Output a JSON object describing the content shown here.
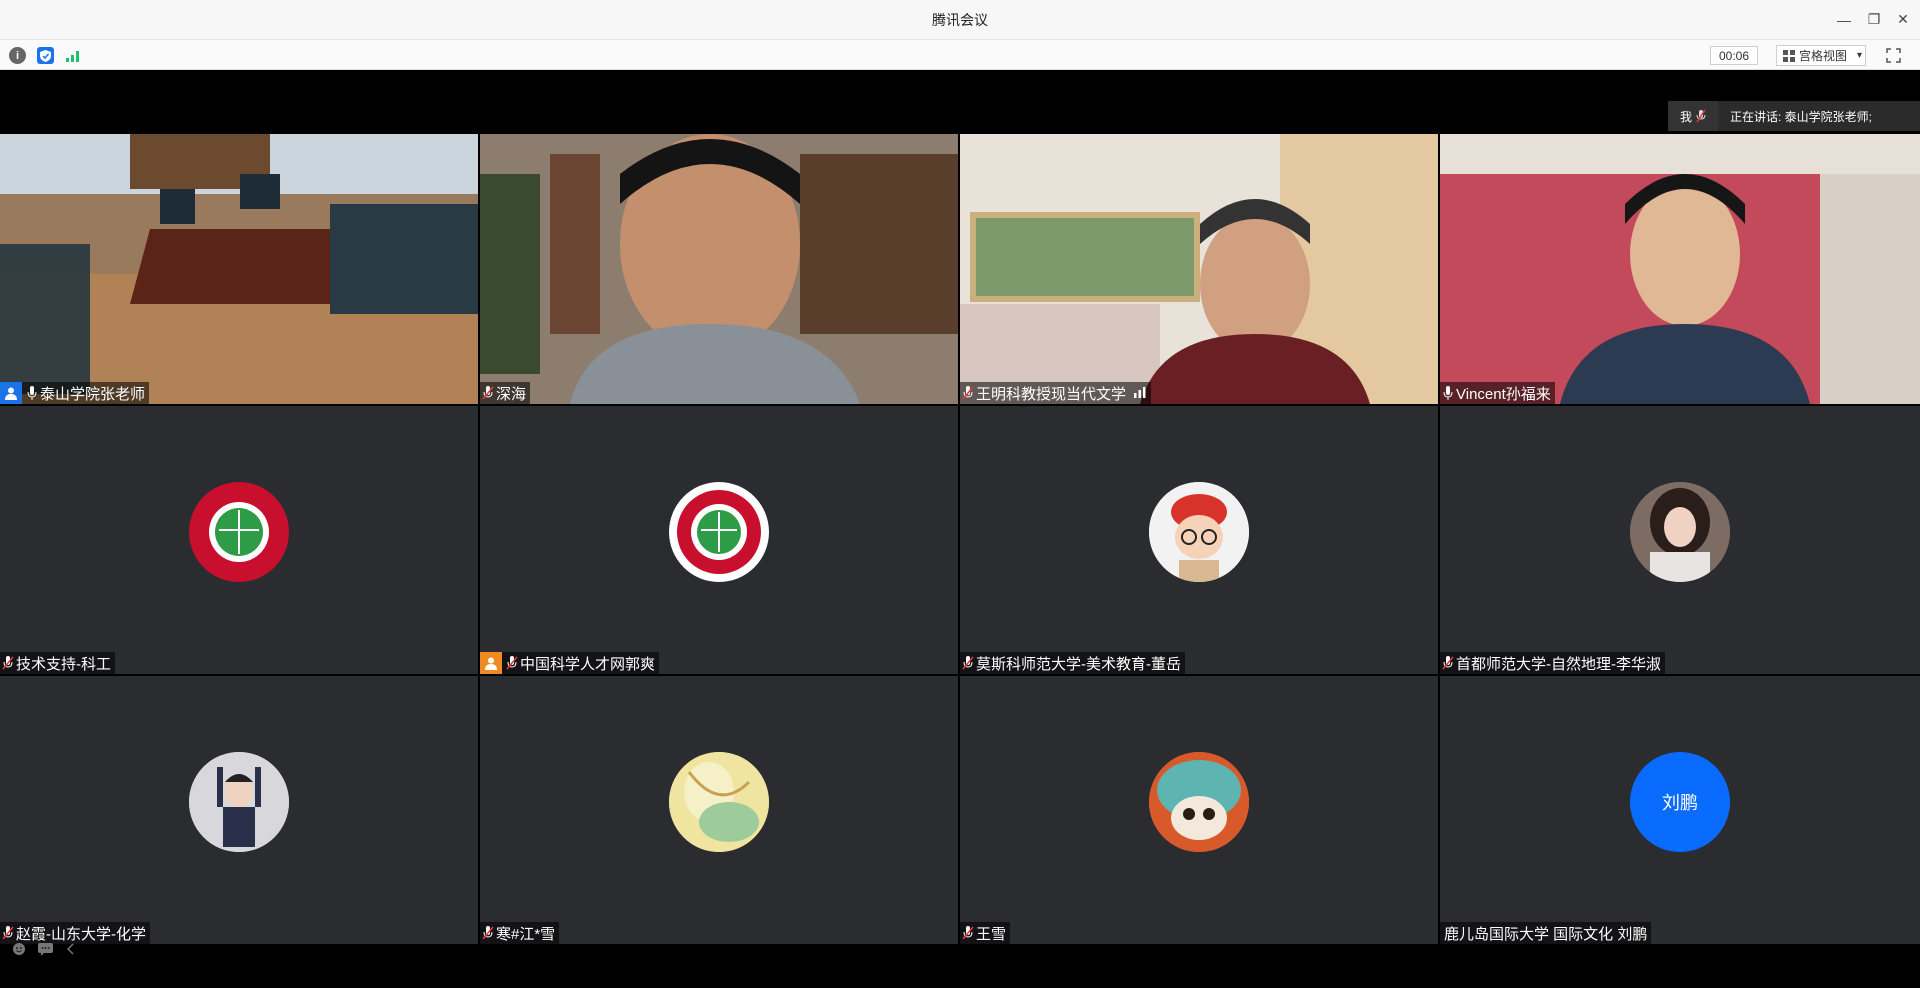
{
  "window": {
    "title": "腾讯会议",
    "minimize_label": "—",
    "restore_label": "❐",
    "close_label": "✕"
  },
  "toolbar": {
    "timer": "00:06",
    "view_label": "宫格视图",
    "view_caret": "▾",
    "info_label": "i"
  },
  "speaking": {
    "me_label": "我",
    "speaker_text": "正在讲话: 泰山学院张老师;"
  },
  "participants": [
    {
      "name": "泰山学院张老师",
      "type": "video",
      "mic": "on",
      "host": true,
      "active": true
    },
    {
      "name": "深海",
      "type": "video",
      "mic": "muted"
    },
    {
      "name": "王明科教授现当代文学",
      "type": "video",
      "mic": "muted",
      "signal": true
    },
    {
      "name": "Vincent孙福来",
      "type": "video",
      "mic": "on"
    },
    {
      "name": "技术支持-科工",
      "type": "avatar",
      "avatar": "kexue-rencai-logo-red",
      "mic": "muted"
    },
    {
      "name": "中国科学人才网郭爽",
      "type": "avatar",
      "avatar": "kexue-rencai-logo-white",
      "mic": "muted",
      "cohost": true
    },
    {
      "name": "莫斯科师范大学-美术教育-董岳",
      "type": "avatar",
      "avatar": "cartoon-boy-glasses",
      "mic": "muted"
    },
    {
      "name": "首都师范大学-自然地理-李华淑",
      "type": "avatar",
      "avatar": "woman-photo",
      "mic": "muted"
    },
    {
      "name": "赵霞-山东大学-化学",
      "type": "avatar",
      "avatar": "child-photo",
      "mic": "muted"
    },
    {
      "name": "寒#江*雪",
      "type": "avatar",
      "avatar": "yellow-painting",
      "mic": "muted"
    },
    {
      "name": "王雪",
      "type": "avatar",
      "avatar": "cat-in-hat",
      "mic": "muted"
    },
    {
      "name": "鹿儿岛国际大学 国际文化 刘鹏",
      "type": "avatar",
      "avatar_text": "刘鹏",
      "mic": "none"
    }
  ],
  "colors": {
    "active_border": "#1fc16b",
    "tile_bg": "#2a2c30",
    "muted_red": "#e53935",
    "initial_avatar": "#0a6cff"
  }
}
